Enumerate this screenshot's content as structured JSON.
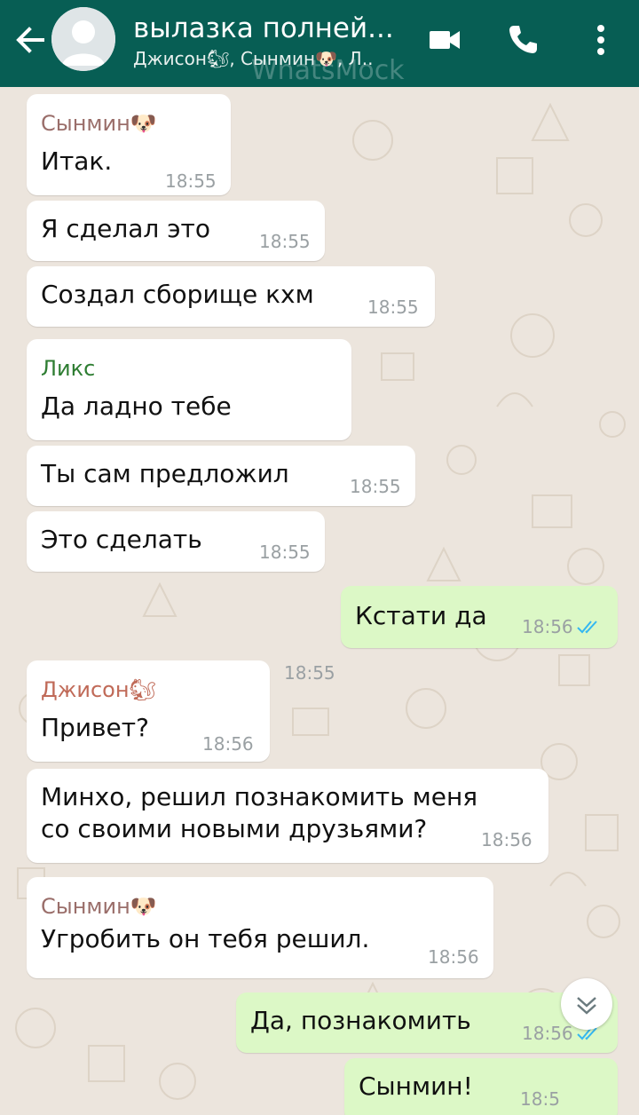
{
  "header": {
    "title": "вылазка полней...",
    "subtitle": "Джисон🐿, Сынмин🐶, Л..",
    "watermark": "WhatsMock",
    "colors": {
      "bar": "#075e54",
      "icons": "#ffffff"
    }
  },
  "icons": {
    "back": "arrow-left-icon",
    "video": "videocam-icon",
    "call": "phone-icon",
    "menu": "more-vert-icon",
    "read": "double-check-icon",
    "scroll": "chevron-down-icon"
  },
  "colors": {
    "incoming": "#ffffff",
    "outgoing": "#dcf8c6",
    "read_ticks": "#34b7f1",
    "sender_seungmin": "#9a6e6a",
    "sender_lix": "#2e7d32",
    "sender_jisung": "#c06a58"
  },
  "messages": [
    {
      "dir": "in",
      "sender": "Сынмин🐶",
      "text": "Итак.",
      "time": "18:55"
    },
    {
      "dir": "in",
      "text": "Я сделал это",
      "time": "18:55"
    },
    {
      "dir": "in",
      "text": "Создал сборище кхм",
      "time": "18:55"
    },
    {
      "dir": "in",
      "sender": "Ликс",
      "text": "Да ладно тебе",
      "time": "18:55"
    },
    {
      "dir": "in",
      "text": "Ты сам предложил",
      "time": "18:55"
    },
    {
      "dir": "in",
      "text": "Это сделать",
      "time": "18:55"
    },
    {
      "dir": "out",
      "text": "Кстати да",
      "time": "18:56",
      "read": true
    },
    {
      "dir": "in",
      "sender": "Джисон🐿",
      "text": "Привет?",
      "time": "18:56"
    },
    {
      "dir": "in",
      "text": "Минхо, решил познакомить меня со своими новыми друзьями?",
      "time": "18:56"
    },
    {
      "dir": "in",
      "sender": "Сынмин🐶",
      "text": "Угробить он тебя решил.",
      "time": "18:56"
    },
    {
      "dir": "out",
      "text": "Да, познакомить",
      "time": "18:56",
      "read": true
    },
    {
      "dir": "out",
      "text": "Сынмин!",
      "time": "18:5"
    }
  ]
}
